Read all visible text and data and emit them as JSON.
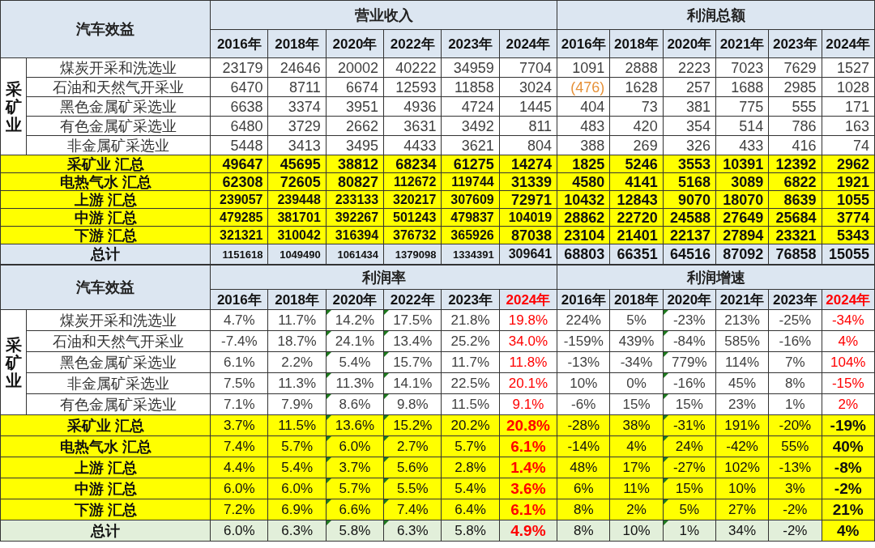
{
  "tables": [
    {
      "title": "汽车效益",
      "side_group": "采矿业",
      "groups": [
        {
          "title": "营业收入",
          "years": [
            {
              "label": "2016年",
              "red": false,
              "flagged": false
            },
            {
              "label": "2018年",
              "red": false,
              "flagged": false
            },
            {
              "label": "2020年",
              "red": false,
              "flagged": false
            },
            {
              "label": "2022年",
              "red": false,
              "flagged": false
            },
            {
              "label": "2023年",
              "red": false,
              "flagged": false
            },
            {
              "label": "2024年",
              "red": false,
              "flagged": false
            }
          ]
        },
        {
          "title": "利润总额",
          "years": [
            {
              "label": "2016年",
              "red": false,
              "flagged": false
            },
            {
              "label": "2018年",
              "red": false,
              "flagged": false
            },
            {
              "label": "2020年",
              "red": false,
              "flagged": false
            },
            {
              "label": "2021年",
              "red": false,
              "flagged": false
            },
            {
              "label": "2023年",
              "red": false,
              "flagged": false
            },
            {
              "label": "2024年",
              "red": false,
              "flagged": false
            }
          ]
        }
      ],
      "rows": [
        {
          "kind": "item",
          "bold": false,
          "label": "煤炭开采和洗选业",
          "cells": [
            "23179",
            "24646",
            "20002",
            "40222",
            "34959",
            "7704",
            "1091",
            "2888",
            "2223",
            "7023",
            "7629",
            "1527"
          ]
        },
        {
          "kind": "item",
          "bold": false,
          "label": "石油和天然气开采业",
          "cells": [
            "6470",
            "8711",
            "6674",
            "12593",
            "11858",
            "3024",
            {
              "text": "(476)",
              "negative": true
            },
            "1628",
            "257",
            "1688",
            "2985",
            "1028"
          ]
        },
        {
          "kind": "item",
          "bold": false,
          "label": "黑色金属矿采选业",
          "cells": [
            "6638",
            "3374",
            "3951",
            "4936",
            "4724",
            "1445",
            "404",
            "73",
            "381",
            "775",
            "555",
            "171"
          ]
        },
        {
          "kind": "item",
          "bold": false,
          "label": "有色金属矿采选业",
          "cells": [
            "6480",
            "3729",
            "2662",
            "3631",
            "3492",
            "811",
            "483",
            "420",
            "354",
            "514",
            "786",
            "163"
          ]
        },
        {
          "kind": "item",
          "bold": false,
          "label": "非金属矿采选业",
          "cells": [
            "5448",
            "3413",
            "3495",
            "4433",
            "3621",
            "804",
            "388",
            "269",
            "326",
            "433",
            "416",
            "74"
          ]
        },
        {
          "kind": "summary",
          "bold": true,
          "label": "采矿业 汇总",
          "cells": [
            "49647",
            "45695",
            "38812",
            "68234",
            "61275",
            "14274",
            "1825",
            "5246",
            "3553",
            "10391",
            "12392",
            "2962"
          ]
        },
        {
          "kind": "summary",
          "bold": true,
          "label": "电热气水 汇总",
          "cells": [
            "62308",
            "72605",
            "80827",
            "112672",
            "119744",
            "31339",
            "4580",
            "4141",
            "5168",
            "3089",
            "6822",
            "1921"
          ]
        },
        {
          "kind": "summary",
          "bold": true,
          "label": "上游 汇总",
          "cells": [
            "239057",
            "239448",
            "233133",
            "320217",
            "307609",
            "72971",
            "10432",
            "12843",
            "9070",
            "18070",
            "8639",
            "1055"
          ]
        },
        {
          "kind": "summary",
          "bold": true,
          "label": "中游 汇总",
          "cells": [
            "479285",
            "381701",
            "392267",
            "501243",
            "479837",
            "104019",
            "28862",
            "22720",
            "24588",
            "27649",
            "25684",
            "3774"
          ]
        },
        {
          "kind": "summary",
          "bold": true,
          "label": "下游 汇总",
          "cells": [
            "321321",
            "310042",
            "316394",
            "376732",
            "365926",
            "87038",
            "23104",
            "21401",
            "22137",
            "27894",
            "23321",
            "5343"
          ]
        },
        {
          "kind": "total",
          "bold": true,
          "label": "总计",
          "cells": [
            "1151618",
            "1049490",
            "1061434",
            "1379098",
            "1334391",
            "309641",
            "68803",
            "66351",
            "64516",
            "87092",
            "76858",
            "15055"
          ]
        }
      ]
    },
    {
      "title": "汽车效益",
      "side_group": "采矿业",
      "groups": [
        {
          "title": "利润率",
          "years": [
            {
              "label": "2016年",
              "red": false,
              "flagged": false
            },
            {
              "label": "2018年",
              "red": false,
              "flagged": false
            },
            {
              "label": "2020年",
              "red": false,
              "flagged": true
            },
            {
              "label": "2022年",
              "red": false,
              "flagged": true
            },
            {
              "label": "2023年",
              "red": false,
              "flagged": false
            },
            {
              "label": "2024年",
              "red": true,
              "flagged": false
            }
          ]
        },
        {
          "title": "利润增速",
          "years": [
            {
              "label": "2016年",
              "red": false,
              "flagged": false
            },
            {
              "label": "2018年",
              "red": false,
              "flagged": false
            },
            {
              "label": "2020年",
              "red": false,
              "flagged": true
            },
            {
              "label": "2021年",
              "red": false,
              "flagged": false
            },
            {
              "label": "2023年",
              "red": false,
              "flagged": false
            },
            {
              "label": "2024年",
              "red": true,
              "flagged": false
            }
          ]
        }
      ],
      "rows": [
        {
          "kind": "item",
          "bold": false,
          "label": "煤炭开采和洗选业",
          "cells": [
            "4.7%",
            "11.7%",
            "14.2%",
            "17.5%",
            "21.8%",
            {
              "text": "19.8%",
              "red": true
            },
            "224%",
            "5%",
            "-23%",
            "213%",
            "-25%",
            {
              "text": "-34%",
              "red": true
            }
          ]
        },
        {
          "kind": "item",
          "bold": false,
          "label": "石油和天然气开采业",
          "cells": [
            "-7.4%",
            "18.7%",
            "24.1%",
            "13.4%",
            "25.2%",
            {
              "text": "34.0%",
              "red": true
            },
            "-159%",
            "439%",
            "-84%",
            "585%",
            "-16%",
            {
              "text": "4%",
              "red": true
            }
          ]
        },
        {
          "kind": "item",
          "bold": false,
          "label": "黑色金属矿采选业",
          "cells": [
            "6.1%",
            "2.2%",
            "5.4%",
            "15.7%",
            "11.7%",
            {
              "text": "11.8%",
              "red": true
            },
            "-13%",
            "-34%",
            "779%",
            "114%",
            "7%",
            {
              "text": "104%",
              "red": true
            }
          ]
        },
        {
          "kind": "item",
          "bold": false,
          "label": "非金属矿采选业",
          "cells": [
            "7.5%",
            "11.3%",
            "11.3%",
            "14.1%",
            "22.5%",
            {
              "text": "20.1%",
              "red": true
            },
            "10%",
            "0%",
            "-16%",
            "45%",
            "8%",
            {
              "text": "-15%",
              "red": true
            }
          ]
        },
        {
          "kind": "item",
          "bold": false,
          "label": "有色金属矿采选业",
          "cells": [
            "7.1%",
            "7.9%",
            "8.6%",
            "9.8%",
            "11.5%",
            {
              "text": "9.1%",
              "red": true
            },
            "-6%",
            "15%",
            "15%",
            "23%",
            "1%",
            {
              "text": "2%",
              "red": true
            }
          ]
        },
        {
          "kind": "summary",
          "bold": false,
          "label": "采矿业 汇总",
          "cells": [
            "3.7%",
            "11.5%",
            "13.6%",
            "15.2%",
            "20.2%",
            {
              "text": "20.8%",
              "red": true,
              "bold": true
            },
            "-28%",
            "38%",
            "-31%",
            "191%",
            "-20%",
            {
              "text": "-19%",
              "red": false,
              "bold": true
            }
          ]
        },
        {
          "kind": "summary",
          "bold": false,
          "label": "电热气水 汇总",
          "cells": [
            "7.4%",
            "5.7%",
            "6.0%",
            "2.7%",
            "5.7%",
            {
              "text": "6.1%",
              "red": true,
              "bold": true
            },
            "-14%",
            "4%",
            "24%",
            "-42%",
            "55%",
            {
              "text": "40%",
              "red": false,
              "bold": true
            }
          ]
        },
        {
          "kind": "summary",
          "bold": false,
          "label": "上游 汇总",
          "cells": [
            "4.4%",
            "5.4%",
            "3.7%",
            "5.6%",
            "2.8%",
            {
              "text": "1.4%",
              "red": true,
              "bold": true
            },
            "48%",
            "17%",
            "-27%",
            "102%",
            "-13%",
            {
              "text": "-8%",
              "red": false,
              "bold": true
            }
          ]
        },
        {
          "kind": "summary",
          "bold": false,
          "label": "中游 汇总",
          "cells": [
            "6.0%",
            "6.0%",
            "5.7%",
            "5.5%",
            "5.4%",
            {
              "text": "3.6%",
              "red": true,
              "bold": true
            },
            "6%",
            "11%",
            "15%",
            "10%",
            "3%",
            {
              "text": "-2%",
              "red": false,
              "bold": true
            }
          ]
        },
        {
          "kind": "summary",
          "bold": false,
          "label": "下游 汇总",
          "cells": [
            "7.2%",
            "6.9%",
            "6.6%",
            "7.4%",
            "6.4%",
            {
              "text": "6.1%",
              "red": true,
              "bold": true
            },
            "8%",
            "2%",
            "5%",
            "27%",
            "-2%",
            {
              "text": "21%",
              "red": false,
              "bold": true
            }
          ]
        },
        {
          "kind": "grandtotal",
          "bold": false,
          "label": "总计",
          "cells": [
            "6.0%",
            "6.3%",
            "5.8%",
            "6.3%",
            "5.8%",
            {
              "text": "4.9%",
              "red": true,
              "bold": true
            },
            "8%",
            "10%",
            "1%",
            "34%",
            "-2%",
            {
              "text": "4%",
              "bold": true,
              "highlight": true
            }
          ]
        }
      ]
    }
  ]
}
